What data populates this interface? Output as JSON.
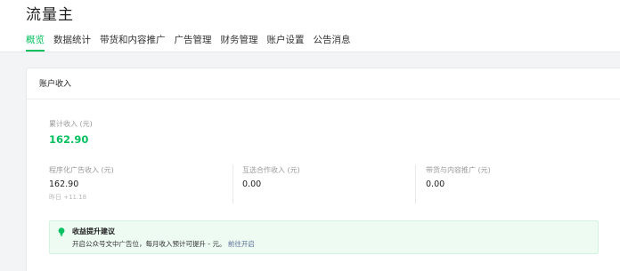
{
  "app": {
    "title": "流量主"
  },
  "tabs": [
    {
      "label": "概览",
      "active": true
    },
    {
      "label": "数据统计",
      "active": false
    },
    {
      "label": "带货和内容推广",
      "active": false
    },
    {
      "label": "广告管理",
      "active": false
    },
    {
      "label": "财务管理",
      "active": false
    },
    {
      "label": "账户设置",
      "active": false
    },
    {
      "label": "公告消息",
      "active": false
    }
  ],
  "account_income": {
    "title": "账户收入",
    "total": {
      "label": "累计收入 (元)",
      "value": "162.90"
    },
    "metrics": [
      {
        "label": "程序化广告收入 (元)",
        "value": "162.90",
        "sub": "昨日 +11.18"
      },
      {
        "label": "互选合作收入 (元)",
        "value": "0.00"
      },
      {
        "label": "带货与内容推广 (元)",
        "value": "0.00"
      }
    ]
  },
  "tip": {
    "icon": "lightbulb-icon",
    "title": "收益提升建议",
    "text": "开启公众号文中广告位，每月收入预计可提升 - 元。",
    "link": "前往开启"
  },
  "colors": {
    "accent": "#07c160",
    "link": "#576b95",
    "tip_background": "#eefbf3"
  }
}
